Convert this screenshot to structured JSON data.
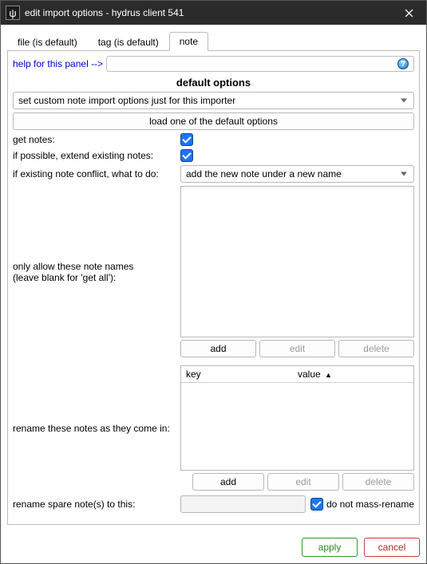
{
  "window": {
    "title": "edit import options - hydrus client 541",
    "icon_glyph": "ψ"
  },
  "tabs": [
    {
      "label": "file (is default)",
      "active": false
    },
    {
      "label": "tag (is default)",
      "active": false
    },
    {
      "label": "note",
      "active": true
    }
  ],
  "help": {
    "link_text": "help for this panel -->",
    "icon_glyph": "?"
  },
  "default_options": {
    "header": "default options",
    "combo_value": "set custom note import options just for this importer",
    "load_button": "load one of the default options"
  },
  "rows": {
    "get_notes_label": "get notes:",
    "get_notes_checked": true,
    "extend_label": "if possible, extend existing notes:",
    "extend_checked": true,
    "conflict_label": "if existing note conflict, what to do:",
    "conflict_value": "add the new note under a new name"
  },
  "allowlist": {
    "label_line1": "only allow these note names",
    "label_line2": "(leave blank for 'get all'):",
    "buttons": {
      "add": "add",
      "edit": "edit",
      "delete": "delete"
    }
  },
  "rename_table": {
    "label": "rename these notes as they come in:",
    "col1": "key",
    "col2": "value",
    "sort_glyph": "▲",
    "buttons": {
      "add": "add",
      "edit": "edit",
      "delete": "delete"
    }
  },
  "spare": {
    "label": "rename spare note(s) to this:",
    "value": "",
    "checkbox_label": "do not mass-rename",
    "checkbox_checked": true
  },
  "footer": {
    "apply": "apply",
    "cancel": "cancel"
  }
}
